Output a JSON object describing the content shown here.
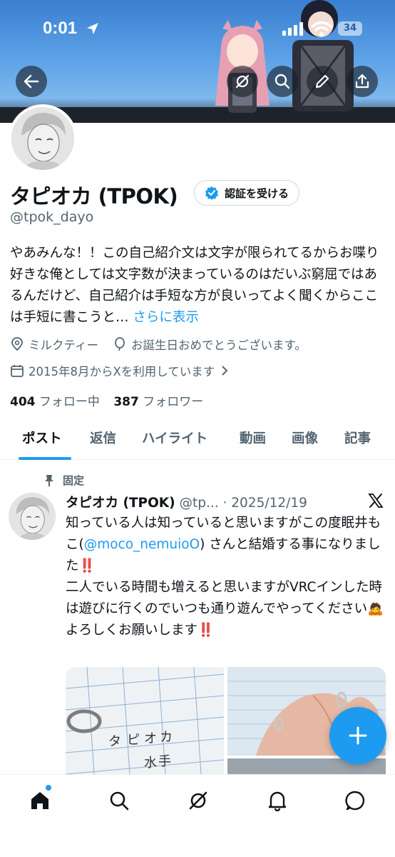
{
  "status_bar": {
    "time": "0:01",
    "battery": "34"
  },
  "profile": {
    "name": "タピオカ (TPOK)",
    "verify_label": "認証を受ける",
    "handle": "@tpok_dayo",
    "bio": "やあみんな！！この自己紹介文は文字が限られてるからお喋り好きな俺としては文字数が決まっているのはだいぶ窮屈ではあるんだけど、自己紹介は手短な方が良いってよく聞くからここは手短に書こうと…",
    "bio_more": "さらに表示",
    "location": "ミルクティー",
    "birthday": "お誕生日おめでとうございます。",
    "joined": "2015年8月からXを利用しています",
    "following_count": "404",
    "following_label": "フォロー中",
    "followers_count": "387",
    "followers_label": "フォロワー"
  },
  "tabs": [
    "ポスト",
    "返信",
    "ハイライト",
    "動画",
    "画像",
    "記事"
  ],
  "post": {
    "pinned_label": "固定",
    "author": "タピオカ (TPOK)",
    "handle_date": "@tp... · 2025/12/19",
    "line1": "知っている人は知っていると思いますがこの度眠井もこ(",
    "mention": "@moco_nemuioO",
    "line2": ") さんと結婚する事になりました",
    "line3": "二人でいる時間も増えると思いますがVRCインした時は遊びに行くのでいつも通り遊んでやってください",
    "line4": "よろしくお願いします",
    "emoji_bangs": "‼️"
  },
  "colors": {
    "accent": "#1d9bf0",
    "text": "#0f1419",
    "muted": "#536471"
  },
  "icons": [
    "back-arrow-icon",
    "grok-icon",
    "search-icon",
    "edit-icon",
    "share-icon",
    "location-icon",
    "balloon-icon",
    "calendar-icon",
    "pin-icon",
    "x-logo-icon",
    "plus-icon",
    "home-icon",
    "notification-bell-icon",
    "messages-icon"
  ]
}
